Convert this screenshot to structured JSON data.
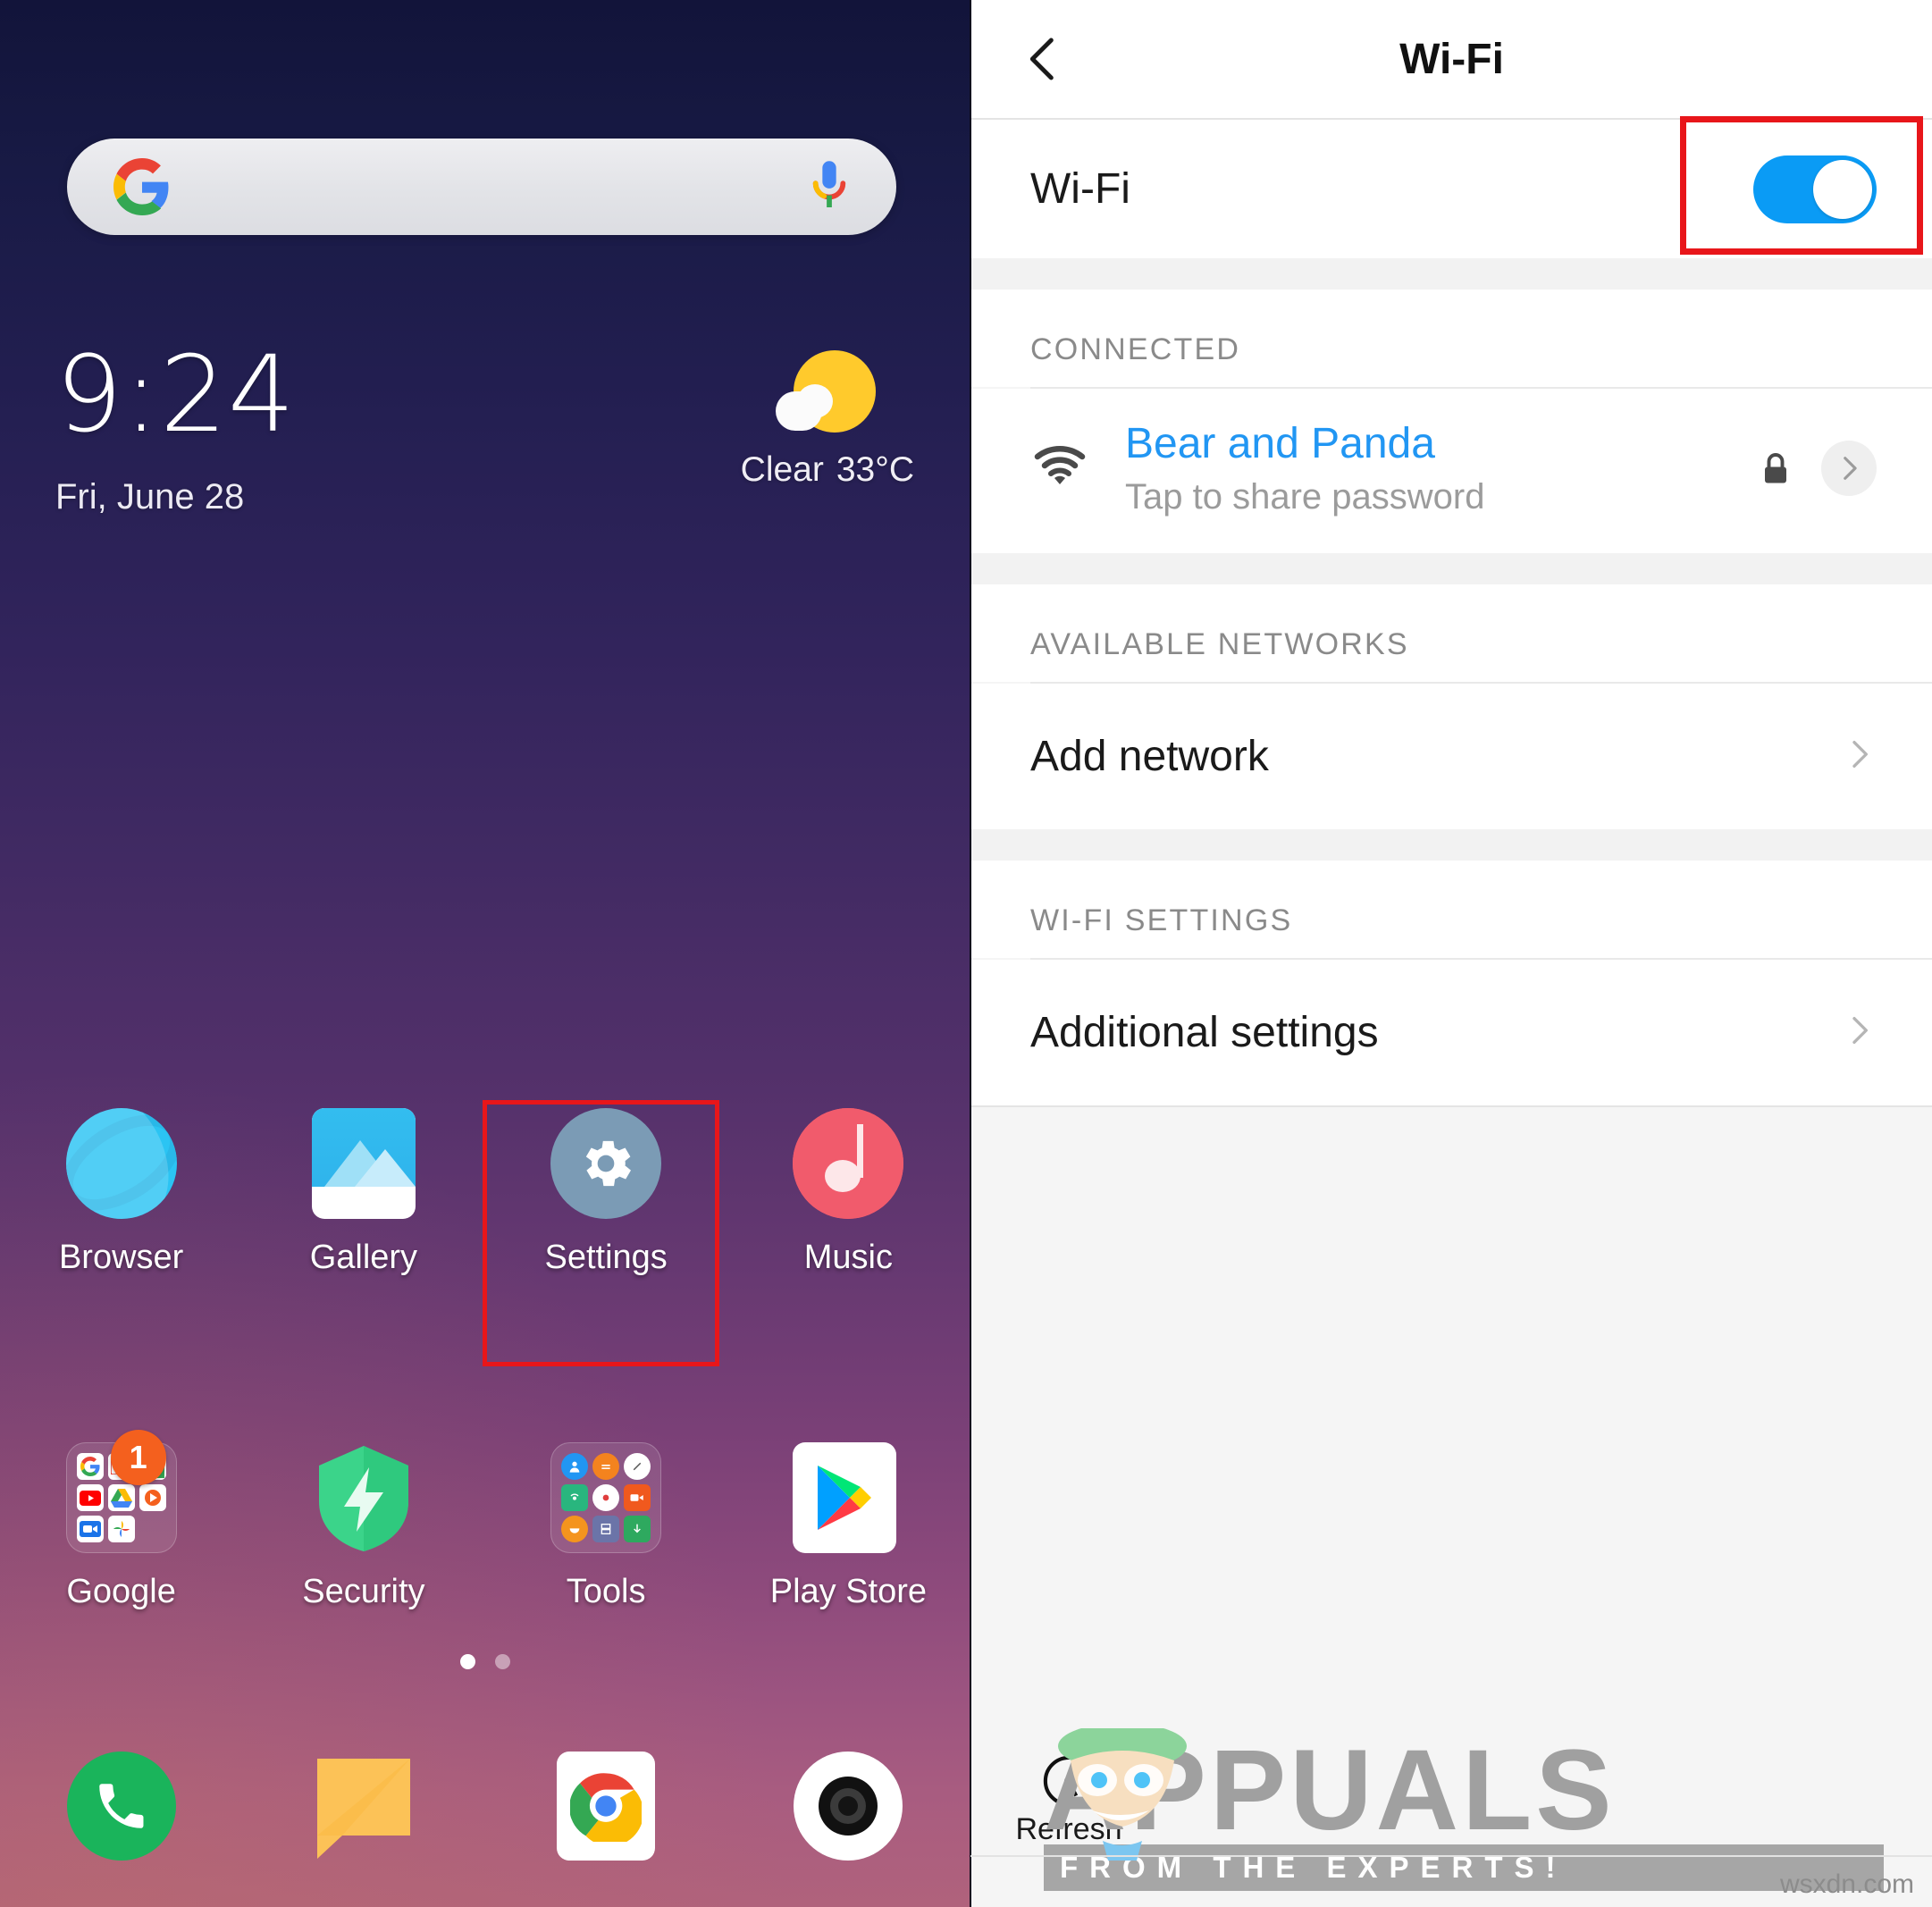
{
  "home": {
    "search": {
      "placeholder": "",
      "google_icon": "google-g-icon",
      "mic_icon": "microphone-icon"
    },
    "clock": {
      "time": "9:24",
      "date": "Fri, June 28"
    },
    "weather": {
      "condition": "Clear",
      "temperature": "33°C",
      "icon": "sun-behind-cloud-icon"
    },
    "apps_row1": [
      {
        "label": "Browser",
        "icon": "browser-icon"
      },
      {
        "label": "Gallery",
        "icon": "gallery-icon"
      },
      {
        "label": "Settings",
        "icon": "settings-gear-icon",
        "highlighted": true
      },
      {
        "label": "Music",
        "icon": "music-note-icon"
      }
    ],
    "apps_row2": [
      {
        "label": "Google",
        "icon": "google-folder-icon",
        "badge": "1"
      },
      {
        "label": "Security",
        "icon": "security-shield-icon"
      },
      {
        "label": "Tools",
        "icon": "tools-folder-icon"
      },
      {
        "label": "Play Store",
        "icon": "play-store-icon"
      }
    ],
    "page_dots": {
      "count": 2,
      "active": 0
    },
    "dock": [
      {
        "icon": "phone-icon"
      },
      {
        "icon": "messages-icon"
      },
      {
        "icon": "chrome-icon"
      },
      {
        "icon": "camera-icon"
      }
    ]
  },
  "wifi": {
    "header": {
      "title": "Wi-Fi",
      "back_icon": "chevron-left-icon"
    },
    "toggle_row": {
      "label": "Wi-Fi",
      "state": "on"
    },
    "connected": {
      "section_label": "CONNECTED",
      "network_name": "Bear and Panda",
      "network_status": "Tap to share password",
      "signal_icon": "wifi-signal-icon",
      "lock_icon": "lock-icon",
      "chevron_icon": "chevron-right-icon"
    },
    "available": {
      "section_label": "AVAILABLE NETWORKS",
      "add_network": "Add network"
    },
    "settings": {
      "section_label": "WI-FI SETTINGS",
      "additional_settings": "Additional settings"
    },
    "refresh": {
      "label": "Refresh",
      "icon": "refresh-icon"
    }
  },
  "watermark": {
    "brand": "APPUALS",
    "tagline": "FROM THE EXPERTS!",
    "source": "wsxdn.com"
  },
  "colors": {
    "accent_blue": "#2196F3",
    "toggle_on": "#0A9BF5",
    "highlight_red": "#E8161A",
    "badge_orange": "#F4601E"
  }
}
